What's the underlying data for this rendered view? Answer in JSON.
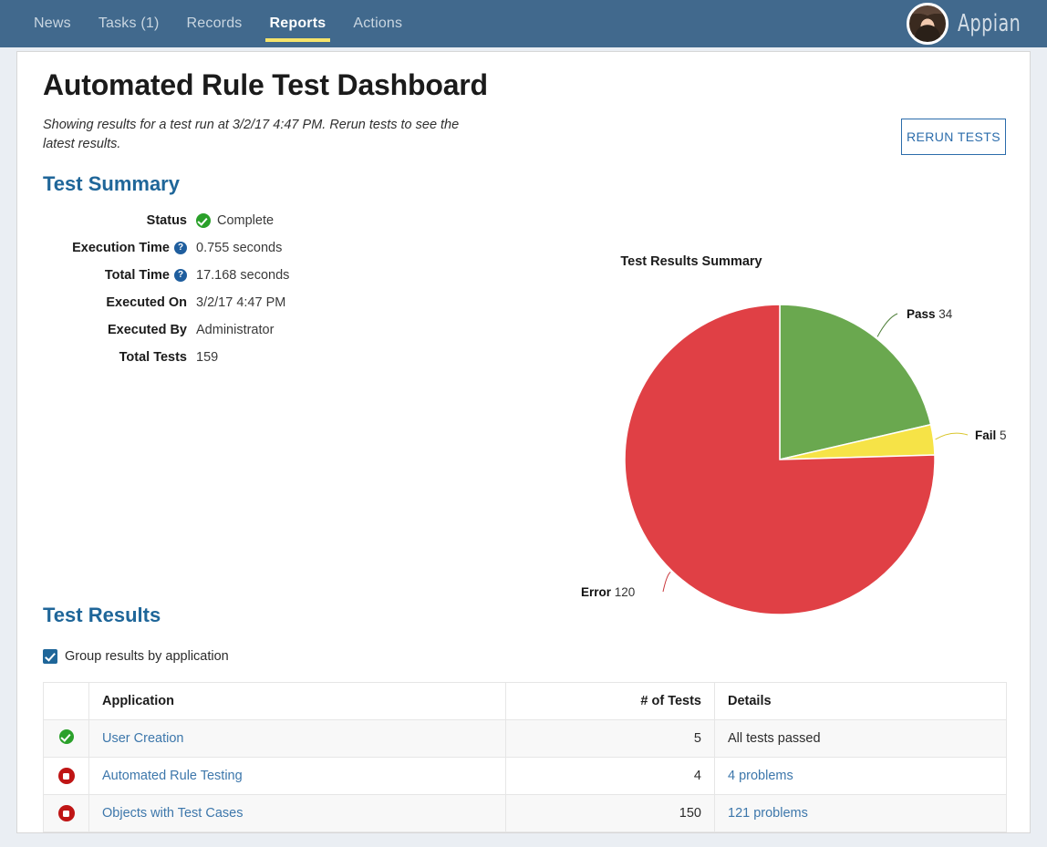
{
  "nav": {
    "tabs": [
      {
        "label": "News",
        "active": false
      },
      {
        "label": "Tasks (1)",
        "active": false
      },
      {
        "label": "Records",
        "active": false
      },
      {
        "label": "Reports",
        "active": true
      },
      {
        "label": "Actions",
        "active": false
      }
    ],
    "brand": "Appian",
    "avatar_alt": "user-avatar"
  },
  "page": {
    "title": "Automated Rule Test Dashboard",
    "subtitle": "Showing results for a test run at 3/2/17 4:47 PM. Rerun tests to see the latest results.",
    "rerun_button": "RERUN TESTS"
  },
  "test_summary": {
    "heading": "Test Summary",
    "rows": [
      {
        "label": "Status",
        "value": "Complete",
        "help": false,
        "status_icon": "check-circle-icon"
      },
      {
        "label": "Execution Time",
        "value": "0.755 seconds",
        "help": true,
        "help_glyph": "?"
      },
      {
        "label": "Total Time",
        "value": "17.168 seconds",
        "help": true,
        "help_glyph": "?"
      },
      {
        "label": "Executed On",
        "value": "3/2/17 4:47 PM",
        "help": false
      },
      {
        "label": "Executed By",
        "value": "Administrator",
        "help": false
      },
      {
        "label": "Total Tests",
        "value": "159",
        "help": false
      }
    ]
  },
  "chart_data": {
    "type": "pie",
    "title": "Test Results Summary",
    "categories": [
      "Pass",
      "Fail",
      "Error"
    ],
    "values": [
      34,
      5,
      120
    ],
    "total": 159,
    "colors": [
      "#6aa84f",
      "#f6e347",
      "#e04045"
    ],
    "labels": [
      {
        "name": "Pass",
        "value": "34"
      },
      {
        "name": "Fail",
        "value": "5"
      },
      {
        "name": "Error",
        "value": "120"
      }
    ],
    "start_angle_deg": 0,
    "direction": "clockwise",
    "legend": "labels-outside",
    "grid": false
  },
  "test_results": {
    "heading": "Test Results",
    "group_checkbox_label": "Group results by application",
    "group_checkbox_checked": true,
    "columns": [
      "",
      "Application",
      "# of Tests",
      "Details"
    ],
    "rows": [
      {
        "status": "pass",
        "application": "User Creation",
        "tests": "5",
        "details": "All tests passed",
        "details_is_link": false
      },
      {
        "status": "error",
        "application": "Automated Rule Testing",
        "tests": "4",
        "details": "4 problems",
        "details_is_link": true
      },
      {
        "status": "error",
        "application": "Objects with Test Cases",
        "tests": "150",
        "details": "121 problems",
        "details_is_link": true
      }
    ]
  },
  "colors": {
    "navbar": "#41698d",
    "accent_tab": "#f5e36a",
    "heading_blue": "#1f6699",
    "link_blue": "#3d77ab",
    "pass_green": "#6aa84f",
    "fail_yellow": "#f6e347",
    "error_red": "#e04045",
    "page_bg": "#eaeef3"
  }
}
